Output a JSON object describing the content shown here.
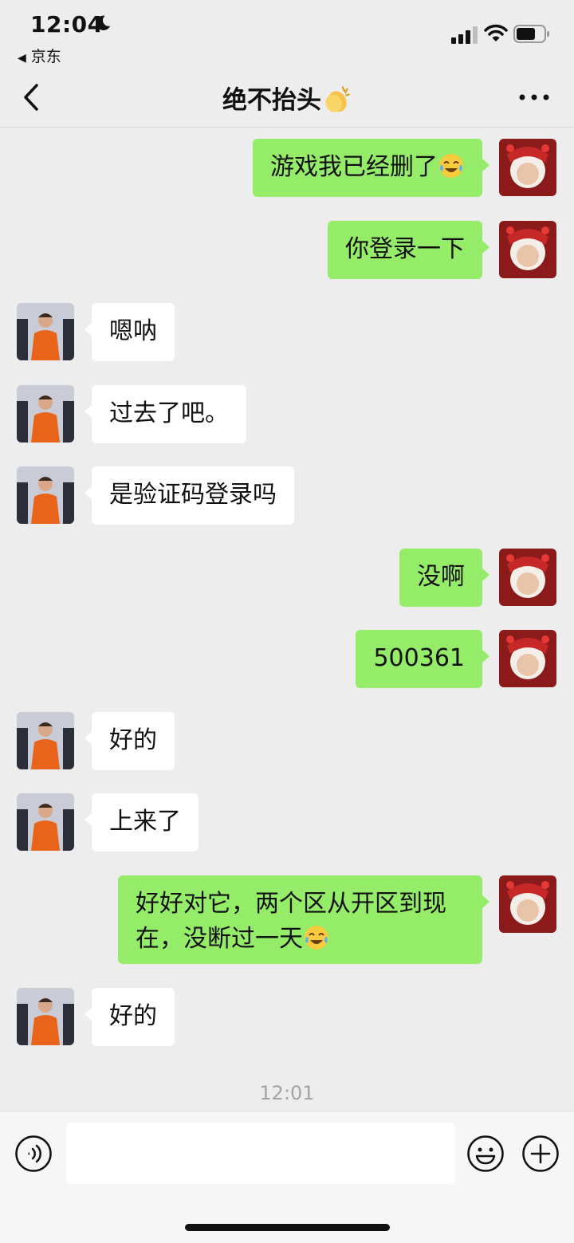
{
  "status_bar": {
    "time": "12:04",
    "back_app": "京东",
    "icons": [
      "moon-icon",
      "signal-icon",
      "wifi-icon",
      "battery-icon"
    ]
  },
  "header": {
    "title": "绝不抬头",
    "title_emoji": "clapping-hands-icon",
    "back_icon": "chevron-left-icon",
    "more_icon": "more-dots-icon"
  },
  "messages": [
    {
      "side": "right",
      "text": "游戏我已经删了",
      "emoji": "crying-laughing-icon"
    },
    {
      "side": "right",
      "text": "你登录一下"
    },
    {
      "side": "left",
      "text": "嗯呐"
    },
    {
      "side": "left",
      "text": "过去了吧。"
    },
    {
      "side": "left",
      "text": "是验证码登录吗"
    },
    {
      "side": "right",
      "text": "没啊"
    },
    {
      "side": "right",
      "text": "500361"
    },
    {
      "side": "left",
      "text": "好的"
    },
    {
      "side": "left",
      "text": "上来了"
    },
    {
      "side": "right",
      "text": "好好对它，两个区从开区到现\n在，没断过一天",
      "emoji": "crying-laughing-icon"
    },
    {
      "side": "left",
      "text": "好的"
    }
  ],
  "timestamp": "12:01",
  "input_bar": {
    "value": "",
    "icons": [
      "voice-icon",
      "emoji-icon",
      "plus-icon"
    ]
  },
  "colors": {
    "background": "#ededed",
    "bubble_mine": "#95ec69",
    "bubble_other": "#ffffff",
    "avatar_mine": "#8b1a1a",
    "avatar_other": "#e8641b"
  }
}
